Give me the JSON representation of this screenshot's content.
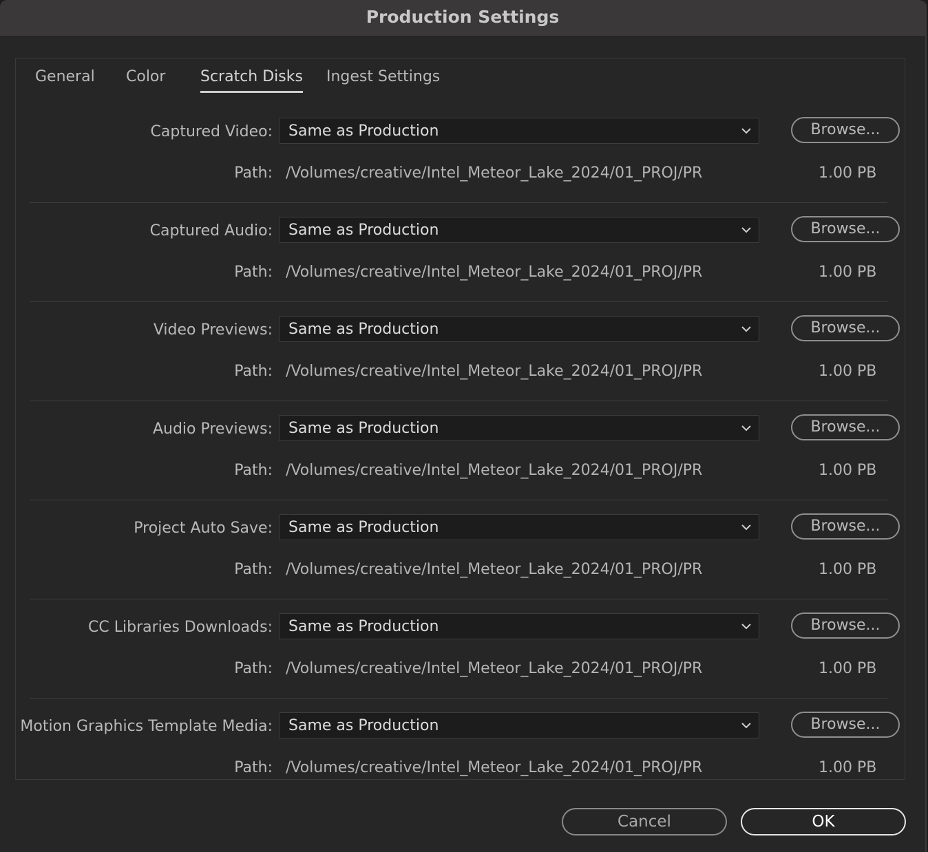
{
  "window": {
    "title": "Production Settings"
  },
  "tabs": [
    {
      "label": "General"
    },
    {
      "label": "Color"
    },
    {
      "label": "Scratch Disks"
    },
    {
      "label": "Ingest Settings"
    }
  ],
  "active_tab": "Scratch Disks",
  "path_label": "Path:",
  "browse_label": "Browse...",
  "rows": [
    {
      "label": "Captured Video:",
      "value": "Same as Production",
      "path": "/Volumes/creative/Intel_Meteor_Lake_2024/01_PROJ/PR",
      "size": "1.00 PB"
    },
    {
      "label": "Captured Audio:",
      "value": "Same as Production",
      "path": "/Volumes/creative/Intel_Meteor_Lake_2024/01_PROJ/PR",
      "size": "1.00 PB"
    },
    {
      "label": "Video Previews:",
      "value": "Same as Production",
      "path": "/Volumes/creative/Intel_Meteor_Lake_2024/01_PROJ/PR",
      "size": "1.00 PB"
    },
    {
      "label": "Audio Previews:",
      "value": "Same as Production",
      "path": "/Volumes/creative/Intel_Meteor_Lake_2024/01_PROJ/PR",
      "size": "1.00 PB"
    },
    {
      "label": "Project Auto Save:",
      "value": "Same as Production",
      "path": "/Volumes/creative/Intel_Meteor_Lake_2024/01_PROJ/PR",
      "size": "1.00 PB"
    },
    {
      "label": "CC Libraries Downloads:",
      "value": "Same as Production",
      "path": "/Volumes/creative/Intel_Meteor_Lake_2024/01_PROJ/PR",
      "size": "1.00 PB"
    },
    {
      "label": "Motion Graphics Template Media:",
      "value": "Same as Production",
      "path": "/Volumes/creative/Intel_Meteor_Lake_2024/01_PROJ/PR",
      "size": "1.00 PB"
    }
  ],
  "footer": {
    "cancel_label": "Cancel",
    "ok_label": "OK"
  },
  "icons": {
    "dropdown": "chevron-down-icon"
  },
  "colors": {
    "background": "#262626",
    "titlebar": "#3a3838",
    "field": "#1c1c1c"
  }
}
